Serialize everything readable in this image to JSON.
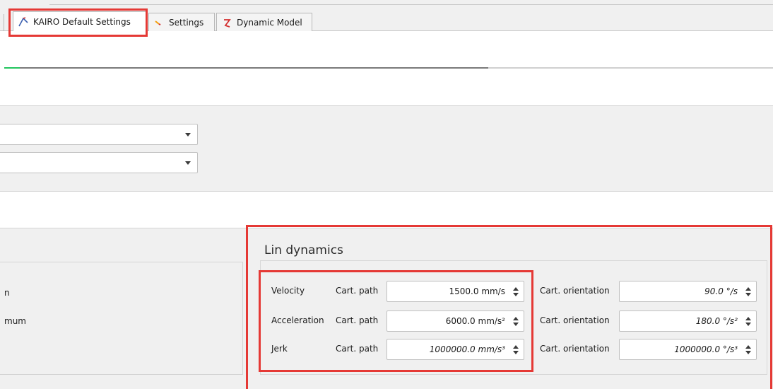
{
  "tabs": [
    {
      "label": "KAIRO Default Settings",
      "icon": "kairo-arm-icon",
      "active": true
    },
    {
      "label": "Settings",
      "icon": "settings-arm-icon",
      "active": false
    },
    {
      "label": "Dynamic Model",
      "icon": "dynamic-model-icon",
      "active": false
    }
  ],
  "progress": {
    "value": 0.63
  },
  "left_panel": {
    "items": [
      "n",
      "mum"
    ]
  },
  "lin_dynamics": {
    "title": "Lin dynamics",
    "rows": [
      {
        "label": "Velocity",
        "path_label": "Cart. path",
        "path_value": "1500.0 mm/s",
        "orient_label": "Cart. orientation",
        "orient_value": "90.0 °/s"
      },
      {
        "label": "Acceleration",
        "path_label": "Cart. path",
        "path_value": "6000.0 mm/s²",
        "orient_label": "Cart. orientation",
        "orient_value": "180.0 °/s²"
      },
      {
        "label": "Jerk",
        "path_label": "Cart. path",
        "path_value": "1000000.0 mm/s³",
        "orient_label": "Cart. orientation",
        "orient_value": "1000000.0 °/s³"
      }
    ]
  },
  "colors": {
    "highlight": "#e53935",
    "progress_start": "#22c55e"
  }
}
